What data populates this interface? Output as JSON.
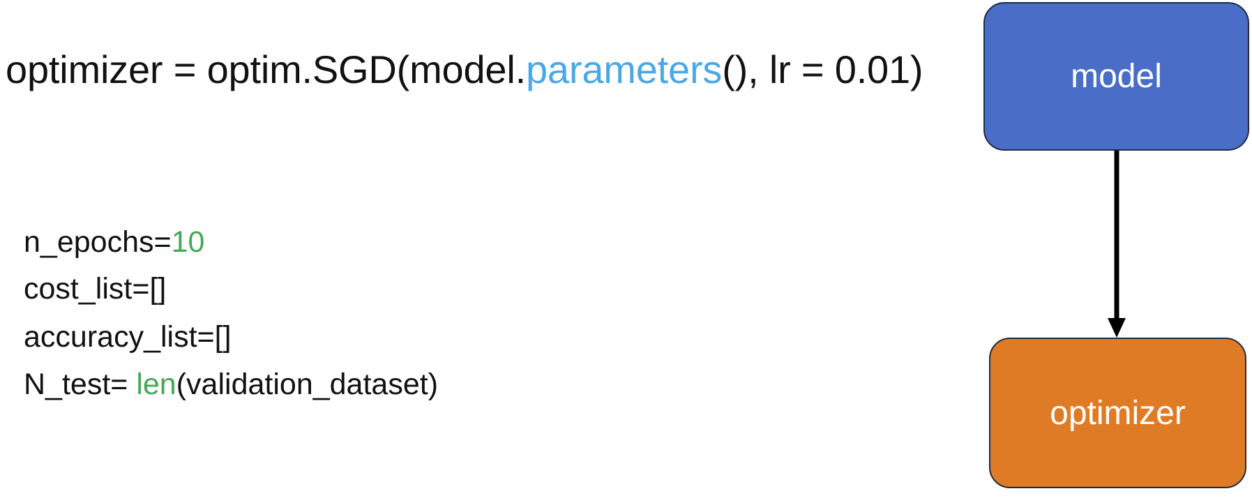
{
  "code": {
    "optimizer_line": {
      "prefix": "optimizer = optim.SGD(model.",
      "method": "parameters",
      "suffix": "(), lr = 0.01)"
    },
    "config_lines": {
      "epochs": {
        "name": "n_epochs=",
        "value": "10"
      },
      "cost": "cost_list=[]",
      "accuracy": "accuracy_list=[]",
      "ntest": {
        "name": "N_test= ",
        "func": "len",
        "rest": "(validation_dataset)"
      }
    }
  },
  "diagram": {
    "nodes": {
      "model": "model",
      "optimizer": "optimizer"
    }
  },
  "colors": {
    "model_box": "#4a6ec7",
    "optimizer_box": "#e07b25",
    "method_highlight": "#4aa8e6",
    "literal_highlight": "#44a857"
  }
}
